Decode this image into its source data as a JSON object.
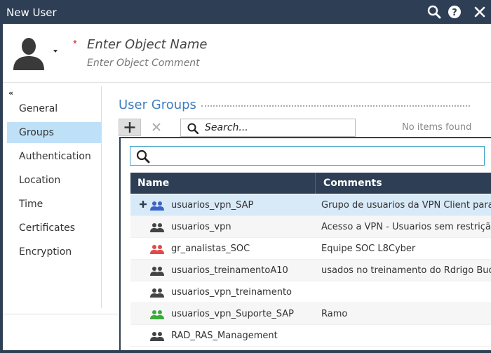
{
  "window": {
    "title": "New User"
  },
  "header": {
    "name_placeholder": "Enter Object Name",
    "comment_placeholder": "Enter Object Comment",
    "required_mark": "*"
  },
  "nav": {
    "collapse_symbol": "«",
    "items": [
      {
        "label": "General"
      },
      {
        "label": "Groups"
      },
      {
        "label": "Authentication"
      },
      {
        "label": "Location"
      },
      {
        "label": "Time"
      },
      {
        "label": "Certificates"
      },
      {
        "label": "Encryption"
      }
    ],
    "active": "Groups"
  },
  "section": {
    "title": "User Groups",
    "search_placeholder": "Search...",
    "empty_text": "No items found"
  },
  "popup": {
    "search_value": "",
    "columns": {
      "name": "Name",
      "comments": "Comments"
    },
    "rows": [
      {
        "name": "usuarios_vpn_SAP",
        "comment": "Grupo de usuarios da VPN Client para...",
        "icon_color": "#3a62c8",
        "selected": true
      },
      {
        "name": "usuarios_vpn",
        "comment": "Acesso a VPN - Usuarios sem restrição",
        "icon_color": "#444444",
        "selected": false
      },
      {
        "name": "gr_analistas_SOC",
        "comment": "Equipe SOC L8Cyber",
        "icon_color": "#e04a4a",
        "selected": false
      },
      {
        "name": "usuarios_treinamentoA10",
        "comment": "usados no treinamento do Rdrigo Bud...",
        "icon_color": "#444444",
        "selected": false
      },
      {
        "name": "usuarios_vpn_treinamento",
        "comment": "",
        "icon_color": "#444444",
        "selected": false
      },
      {
        "name": "usuarios_vpn_Suporte_SAP",
        "comment": "Ramo",
        "icon_color": "#3caa3c",
        "selected": false
      },
      {
        "name": "RAD_RAS_Management",
        "comment": "",
        "icon_color": "#444444",
        "selected": false
      }
    ]
  },
  "colors": {
    "chrome": "#2e3f55",
    "accent": "#3f7dc0",
    "nav_active": "#bfe1f8",
    "row_selected": "#d8e9f7"
  },
  "icons": {
    "search": "search-icon",
    "help": "help-icon",
    "close": "close-icon",
    "add": "plus-icon",
    "remove": "x-icon",
    "group": "user-group-icon",
    "avatar": "user-avatar-icon"
  }
}
